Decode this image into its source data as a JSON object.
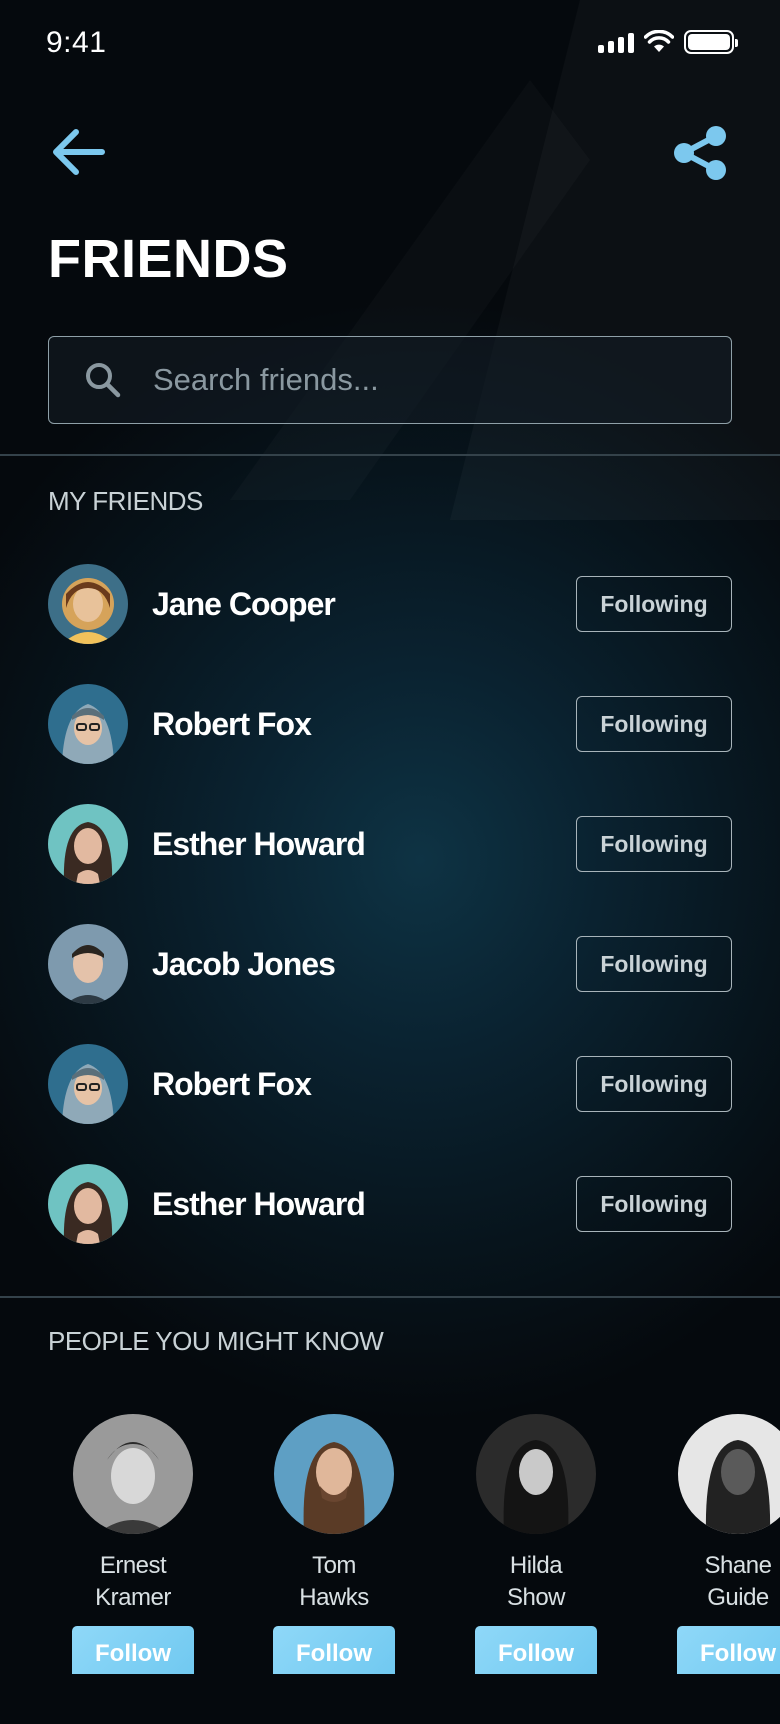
{
  "status_bar": {
    "time": "9:41"
  },
  "header": {
    "title": "FRIENDS"
  },
  "search": {
    "placeholder": "Search friends..."
  },
  "my_friends": {
    "section_title": "MY FRIENDS",
    "items": [
      {
        "name": "Jane Cooper",
        "button": "Following"
      },
      {
        "name": "Robert Fox",
        "button": "Following"
      },
      {
        "name": "Esther Howard",
        "button": "Following"
      },
      {
        "name": "Jacob Jones",
        "button": "Following"
      },
      {
        "name": "Robert Fox",
        "button": "Following"
      },
      {
        "name": "Esther Howard",
        "button": "Following"
      }
    ]
  },
  "suggestions": {
    "section_title": "PEOPLE YOU MIGHT KNOW",
    "items": [
      {
        "first": "Ernest",
        "last": "Kramer",
        "button": "Follow"
      },
      {
        "first": "Tom",
        "last": "Hawks",
        "button": "Follow"
      },
      {
        "first": "Hilda",
        "last": "Show",
        "button": "Follow"
      },
      {
        "first": "Shane",
        "last": "Guide",
        "button": "Follow"
      }
    ]
  },
  "colors": {
    "accent": "#6fc8f0",
    "background": "#07141c",
    "border": "#a8b4ba"
  }
}
